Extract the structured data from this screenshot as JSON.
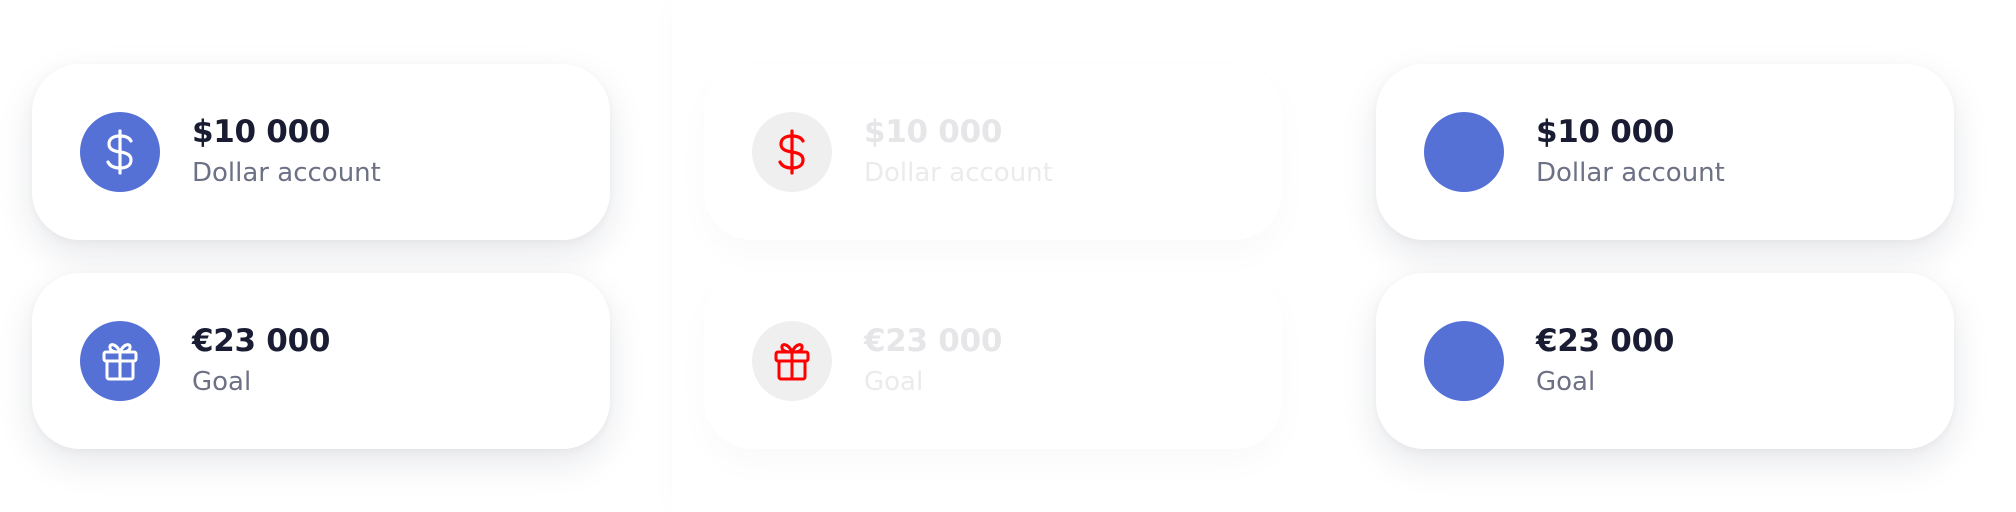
{
  "panels": [
    {
      "variant": "default",
      "cards": [
        {
          "amount": "$10 000",
          "label": "Dollar account",
          "icon": "dollar-icon",
          "icon_color": "#ffffff",
          "circle_color": "#5571d6"
        },
        {
          "amount": "€23 000",
          "label": "Goal",
          "icon": "gift-icon",
          "icon_color": "#ffffff",
          "circle_color": "#5571d6"
        }
      ]
    },
    {
      "variant": "disabled",
      "cards": [
        {
          "amount": "$10 000",
          "label": "Dollar account",
          "icon": "dollar-icon",
          "icon_color": "#ff0000",
          "circle_color": "#efefef"
        },
        {
          "amount": "€23 000",
          "label": "Goal",
          "icon": "gift-icon",
          "icon_color": "#ff0000",
          "circle_color": "#efefef"
        }
      ]
    },
    {
      "variant": "no-icon",
      "cards": [
        {
          "amount": "$10 000",
          "label": "Dollar account",
          "circle_color": "#5571d6"
        },
        {
          "amount": "€23 000",
          "label": "Goal",
          "circle_color": "#5571d6"
        }
      ]
    }
  ],
  "colors": {
    "accent": "#5571d6",
    "amount_text": "#1a1c33",
    "label_text": "#6d7185",
    "disabled_icon": "#ff0000"
  }
}
